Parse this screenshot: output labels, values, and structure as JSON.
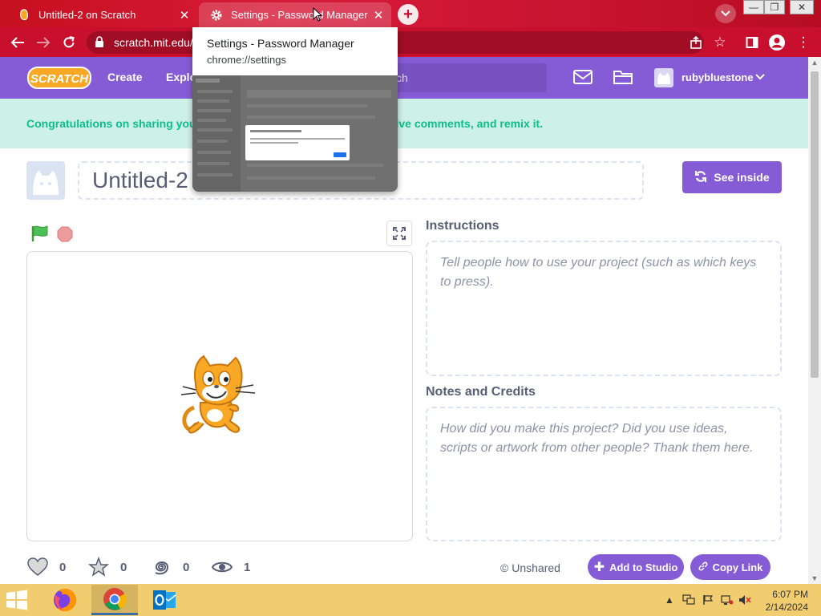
{
  "browser": {
    "tabs": [
      {
        "title": "Untitled-2 on Scratch"
      },
      {
        "title": "Settings - Password Manager"
      }
    ],
    "url": "scratch.mit.edu/"
  },
  "tab_preview": {
    "title": "Settings - Password Manager",
    "url": "chrome://settings"
  },
  "scratch_nav": {
    "create": "Create",
    "explore": "Explo",
    "search_placeholder": "ch",
    "username": "rubybluestone"
  },
  "banner": {
    "text": "Congratulations on sharing you                                                    bout, give comments, and remix it."
  },
  "project": {
    "title": "Untitled-2",
    "see_inside": "See inside",
    "instructions_label": "Instructions",
    "instructions_placeholder": "Tell people how to use your project (such as which keys to press).",
    "notes_label": "Notes and Credits",
    "notes_placeholder": "How did you make this project? Did you use ideas, scripts or artwork from other people? Thank them here.",
    "stats": {
      "loves": "0",
      "favorites": "0",
      "remixes": "0",
      "views": "1"
    },
    "share_status": "Unshared",
    "add_to_studio": "Add to Studio",
    "copy_link": "Copy Link"
  },
  "taskbar": {
    "time": "6:07 PM",
    "date": "2/14/2024"
  },
  "colors": {
    "chrome_red": "#c8102e",
    "scratch_purple": "#855cd6",
    "banner_bg": "#cdf1e6",
    "banner_text": "#0fbd8c",
    "taskbar": "#f2cd6f"
  }
}
